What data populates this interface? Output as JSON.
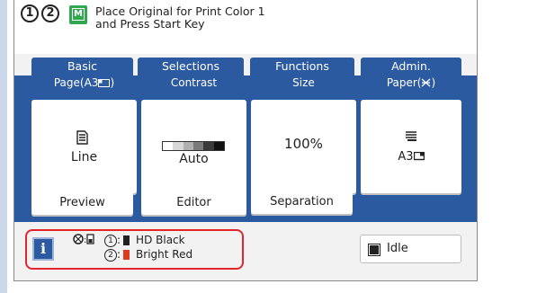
{
  "header": {
    "ordinal1": "1",
    "ordinal2": "2",
    "mode_icon_letter": "M",
    "message_line1": "Place Original for Print Color 1",
    "message_line2": "and Press Start Key"
  },
  "tabs": [
    {
      "label": "Basic"
    },
    {
      "label": "Selections"
    },
    {
      "label": "Functions"
    },
    {
      "label": "Admin."
    }
  ],
  "settings": {
    "page": {
      "caption": "Page(A3",
      "caption_suffix": ")",
      "value": "Line"
    },
    "contrast": {
      "caption": "Contrast",
      "value": "Auto"
    },
    "size": {
      "caption": "Size",
      "value": "100%"
    },
    "paper": {
      "caption": "Paper(",
      "caption_suffix": ")",
      "value": "A3"
    }
  },
  "actions": {
    "preview": "Preview",
    "editor": "Editor",
    "separation": "Separation"
  },
  "status": {
    "info_label": "i",
    "color1_num": "1",
    "color1_name": "HD Black",
    "color2_num": "2",
    "color2_name": "Bright Red",
    "idle_label": "Idle"
  },
  "colors": {
    "accent": "#2c5aa0",
    "highlight": "#e0262c",
    "mode_icon": "#2fa84f",
    "hd_black": "#222222",
    "bright_red": "#e03a1e"
  }
}
